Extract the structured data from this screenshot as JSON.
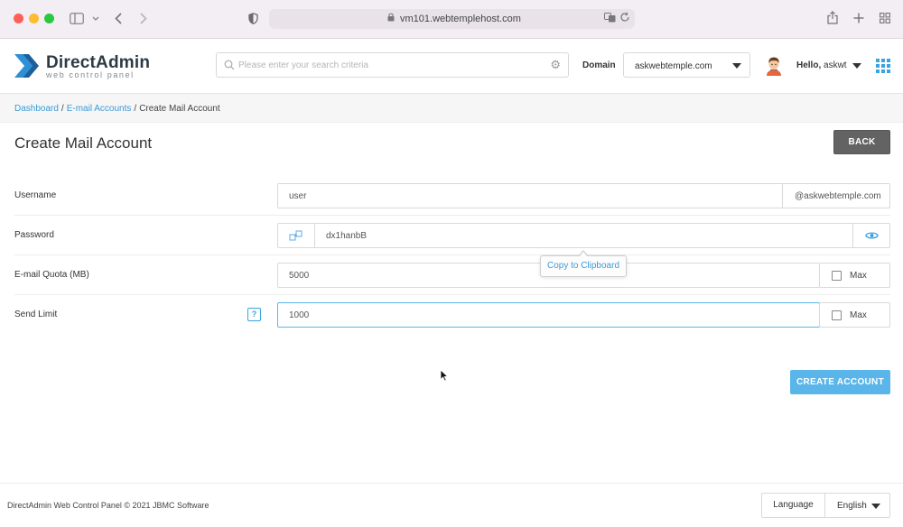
{
  "browser": {
    "url": "vm101.webtemplehost.com",
    "icons": [
      "sidebar-icon",
      "chevron-down-icon",
      "back-arrow-icon",
      "forward-arrow-icon",
      "shield-icon",
      "lock-icon",
      "translate-icon",
      "reload-icon",
      "share-icon",
      "new-tab-icon",
      "tab-overview-icon"
    ]
  },
  "header": {
    "logo_title": "DirectAdmin",
    "logo_subtitle": "web control panel",
    "search_placeholder": "Please enter your search criteria",
    "domain_label": "Domain",
    "domain_value": "askwebtemple.com",
    "hello_prefix": "Hello,",
    "username": "askwt",
    "accent_color": "#3aa4e0"
  },
  "breadcrumb": {
    "items": [
      "Dashboard",
      "E-mail Accounts",
      "Create Mail Account"
    ],
    "separator": "/"
  },
  "page": {
    "title": "Create Mail Account",
    "back_label": "BACK"
  },
  "form": {
    "username": {
      "label": "Username",
      "value": "user",
      "suffix": "@askwebtemple.com"
    },
    "password": {
      "label": "Password",
      "value": "dx1hanbB",
      "tooltip": "Copy to Clipboard"
    },
    "quota": {
      "label": "E-mail Quota (MB)",
      "value": "5000",
      "max_label": "Max",
      "max_checked": false
    },
    "send_limit": {
      "label": "Send Limit",
      "help": "?",
      "value": "1000",
      "max_label": "Max",
      "max_checked": false
    },
    "submit_label": "CREATE ACCOUNT"
  },
  "footer": {
    "copyright": "DirectAdmin Web Control Panel © 2021 JBMC Software",
    "language_label": "Language",
    "language_value": "English"
  }
}
